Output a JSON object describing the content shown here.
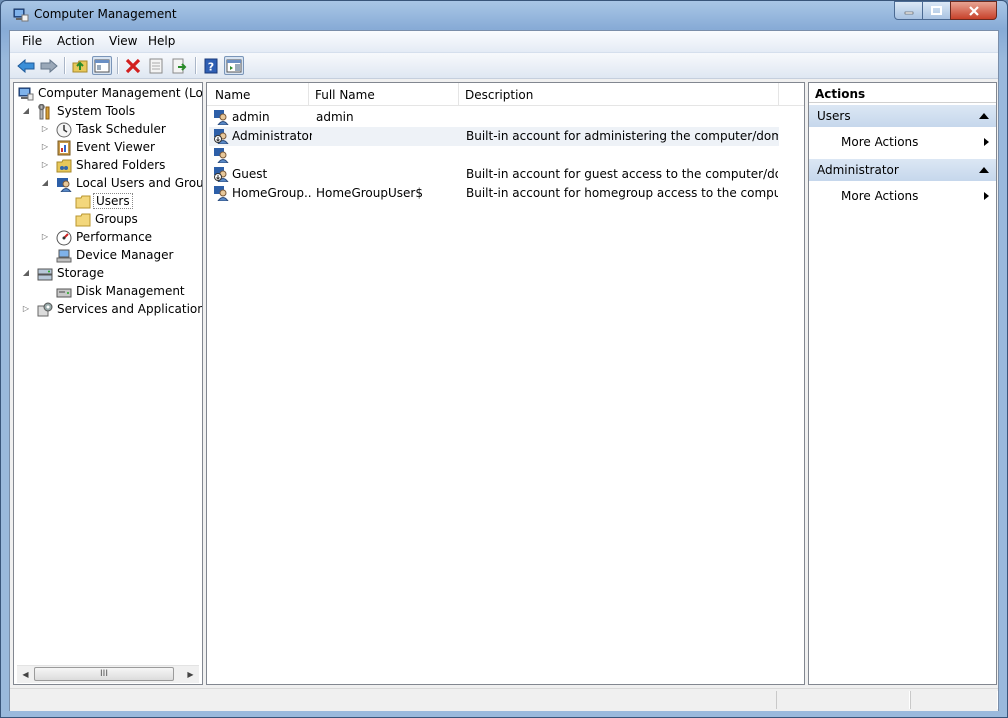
{
  "window": {
    "title": "Computer Management"
  },
  "menu": [
    "File",
    "Action",
    "View",
    "Help"
  ],
  "tree": [
    {
      "label": "Computer Management (Local",
      "icon": "computer-icon",
      "arrow": ""
    },
    {
      "label": "System Tools",
      "icon": "tools-icon",
      "arrow": "expanded"
    },
    {
      "label": "Task Scheduler",
      "icon": "clock-icon",
      "arrow": "collapsed"
    },
    {
      "label": "Event Viewer",
      "icon": "event-viewer-icon",
      "arrow": "collapsed"
    },
    {
      "label": "Shared Folders",
      "icon": "shared-folder-icon",
      "arrow": "collapsed"
    },
    {
      "label": "Local Users and Groups",
      "icon": "users-icon",
      "arrow": "expanded"
    },
    {
      "label": "Users",
      "icon": "folder-icon",
      "arrow": "",
      "selected": true
    },
    {
      "label": "Groups",
      "icon": "folder-icon",
      "arrow": ""
    },
    {
      "label": "Performance",
      "icon": "performance-icon",
      "arrow": "collapsed"
    },
    {
      "label": "Device Manager",
      "icon": "device-manager-icon",
      "arrow": ""
    },
    {
      "label": "Storage",
      "icon": "storage-icon",
      "arrow": "expanded"
    },
    {
      "label": "Disk Management",
      "icon": "disk-icon",
      "arrow": ""
    },
    {
      "label": "Services and Applications",
      "icon": "services-icon",
      "arrow": "collapsed"
    }
  ],
  "list": {
    "columns": [
      "Name",
      "Full Name",
      "Description"
    ],
    "rows": [
      {
        "name": "admin",
        "full_name": "admin",
        "description": ""
      },
      {
        "name": "Administrator",
        "full_name": "",
        "description": "Built-in account for administering the computer/domain"
      },
      {
        "name": "",
        "full_name": "",
        "description": ""
      },
      {
        "name": "Guest",
        "full_name": "",
        "description": "Built-in account for guest access to the computer/domain"
      },
      {
        "name": "HomeGroup...",
        "full_name": "HomeGroupUser$",
        "description": "Built-in account for homegroup access to the computer"
      }
    ]
  },
  "actions": {
    "title": "Actions",
    "sections": [
      {
        "title": "Users",
        "items": [
          "More Actions"
        ]
      },
      {
        "title": "Administrator",
        "items": [
          "More Actions"
        ]
      }
    ]
  },
  "scroll_glyph": "III"
}
